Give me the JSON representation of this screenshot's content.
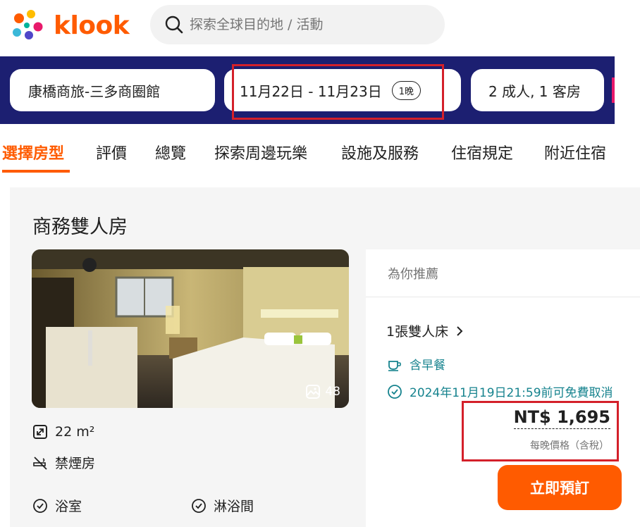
{
  "header": {
    "brand": "klook",
    "search_placeholder": "探索全球目的地 / 活動"
  },
  "booking": {
    "hotel": "康橋商旅-三多商圈館",
    "dates": "11月22日 - 11月23日",
    "nights": "1晚",
    "guests": "2 成人, 1 客房"
  },
  "tabs": [
    {
      "label": "選擇房型",
      "active": true
    },
    {
      "label": "評價"
    },
    {
      "label": "總覽"
    },
    {
      "label": "探索周邊玩樂"
    },
    {
      "label": "設施及服務"
    },
    {
      "label": "住宿規定"
    },
    {
      "label": "附近住宿"
    }
  ],
  "room": {
    "title": "商務雙人房",
    "photo_count": "48",
    "size": "22 m²",
    "smoking": "禁煙房",
    "amenities": [
      "浴室",
      "淋浴間"
    ]
  },
  "rate": {
    "header": "為你推薦",
    "bed": "1張雙人床",
    "breakfast": "含早餐",
    "cancellation": "2024年11月19日21:59前可免費取消",
    "price": "NT$ 1,695",
    "price_note": "每晚價格（含稅）",
    "book_label": "立即預訂"
  },
  "colors": {
    "brand": "#ff5b00",
    "navy": "#1c1f71",
    "teal": "#16838e",
    "highlight": "#d4202a"
  }
}
